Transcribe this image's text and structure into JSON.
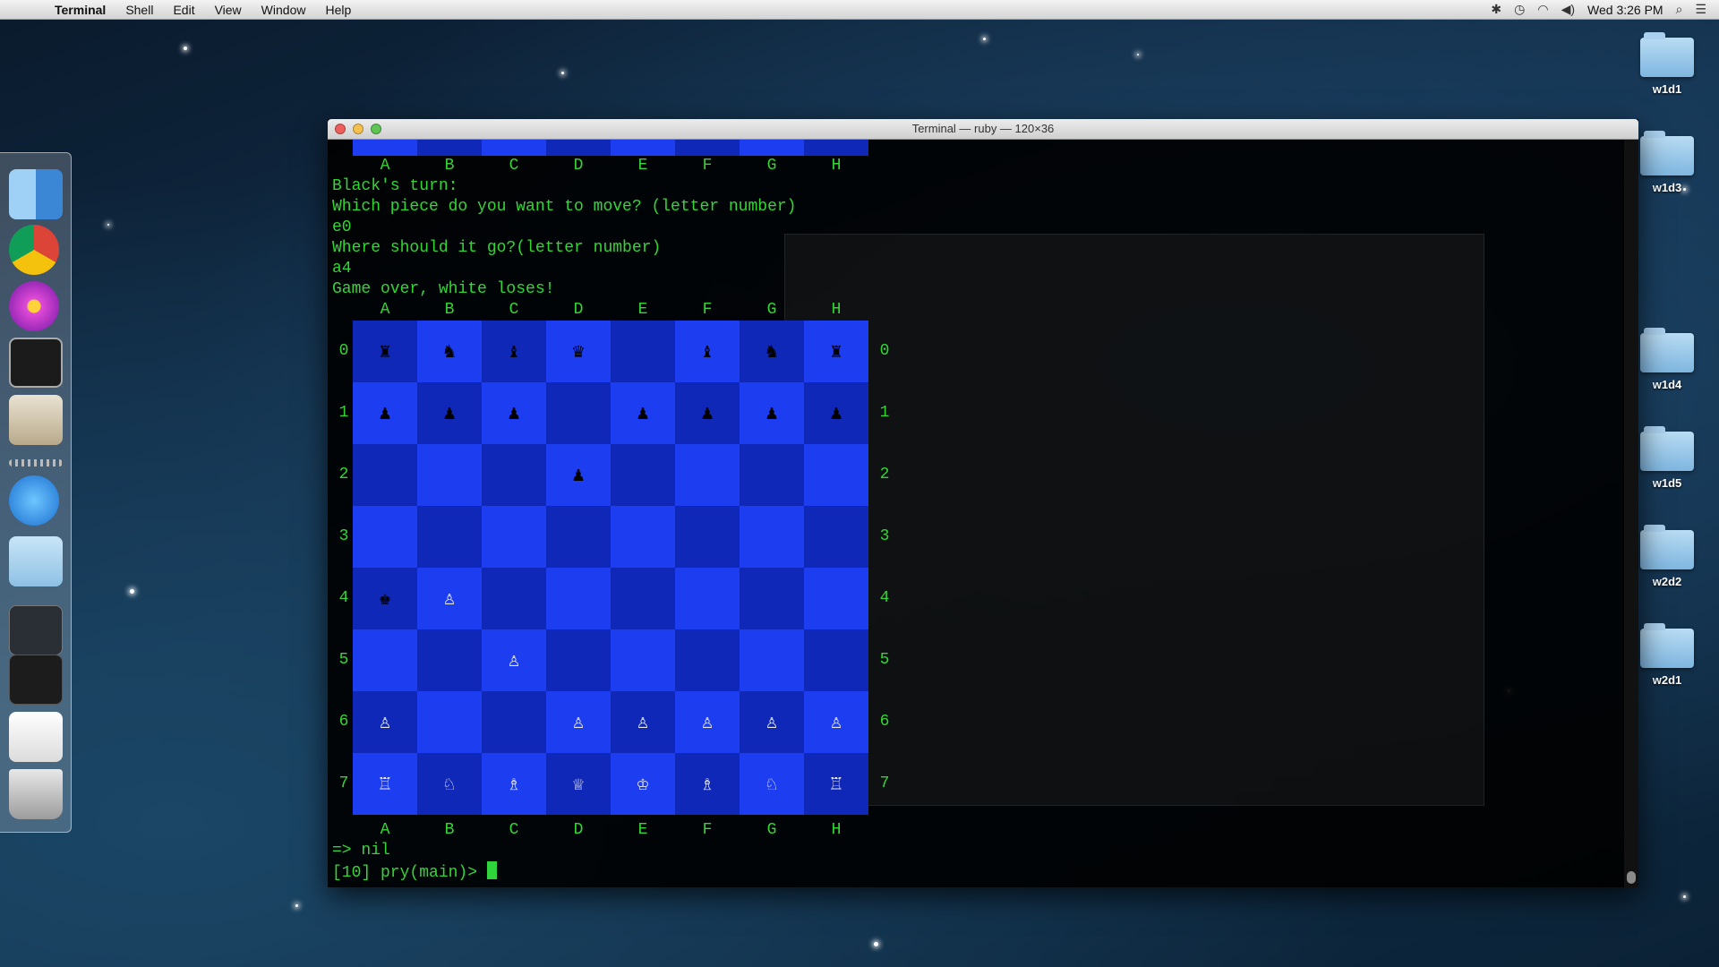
{
  "menubar": {
    "app_name": "Terminal",
    "menus": [
      "Shell",
      "Edit",
      "View",
      "Window",
      "Help"
    ],
    "clock": "Wed 3:26 PM"
  },
  "desktop": {
    "folders": [
      "w1d1",
      "w1d3",
      "w1d4",
      "w1d5",
      "w2d2",
      "w2d1"
    ]
  },
  "dock": {
    "items": [
      "Finder",
      "Chrome",
      "Flower",
      "Terminal",
      "Preview",
      "App Store",
      "Documents",
      "Screenshots",
      "Recent",
      "Chrome Window",
      "Trash"
    ]
  },
  "terminal": {
    "title": "Terminal — ruby — 120×36",
    "prelude_files": "A     B     C     D     E     F     G     H",
    "lines": [
      "Black's turn:",
      "Which piece do you want to move? (letter number)",
      "e0",
      "Where should it go?(letter number)",
      "a4",
      "Game over, white loses!"
    ],
    "result": "=> nil",
    "prompt": "[10] pry(main)> "
  },
  "board": {
    "files": [
      "A",
      "B",
      "C",
      "D",
      "E",
      "F",
      "G",
      "H"
    ],
    "ranks": [
      "0",
      "1",
      "2",
      "3",
      "4",
      "5",
      "6",
      "7"
    ],
    "colors": {
      "light": "#1c3df0",
      "dark": "#0f28b8",
      "black_piece": "#000000",
      "white_piece": "#e8e8e8"
    },
    "pieces": [
      [
        "♜",
        "♞",
        "♝",
        "♛",
        "",
        "♝",
        "♞",
        "♜"
      ],
      [
        "♟",
        "♟",
        "♟",
        "",
        "♟",
        "♟",
        "♟",
        "♟"
      ],
      [
        "",
        "",
        "",
        "♟",
        "",
        "",
        "",
        ""
      ],
      [
        "",
        "",
        "",
        "",
        "",
        "",
        "",
        ""
      ],
      [
        "♚",
        "♙",
        "",
        "",
        "",
        "",
        "",
        ""
      ],
      [
        "",
        "",
        "♙",
        "",
        "",
        "",
        "",
        ""
      ],
      [
        "♙",
        "",
        "",
        "♙",
        "♙",
        "♙",
        "♙",
        "♙"
      ],
      [
        "♖",
        "♘",
        "♗",
        "♕",
        "♔",
        "♗",
        "♘",
        "♖"
      ]
    ],
    "piece_colors": [
      [
        "b",
        "b",
        "b",
        "b",
        "",
        "b",
        "b",
        "b"
      ],
      [
        "b",
        "b",
        "b",
        "",
        "b",
        "b",
        "b",
        "b"
      ],
      [
        "",
        "",
        "",
        "b",
        "",
        "",
        "",
        ""
      ],
      [
        "",
        "",
        "",
        "",
        "",
        "",
        "",
        ""
      ],
      [
        "b",
        "w",
        "",
        "",
        "",
        "",
        "",
        ""
      ],
      [
        "",
        "",
        "w",
        "",
        "",
        "",
        "",
        ""
      ],
      [
        "w",
        "",
        "",
        "w",
        "w",
        "w",
        "w",
        "w"
      ],
      [
        "w",
        "w",
        "w",
        "w",
        "w",
        "w",
        "w",
        "w"
      ]
    ]
  }
}
